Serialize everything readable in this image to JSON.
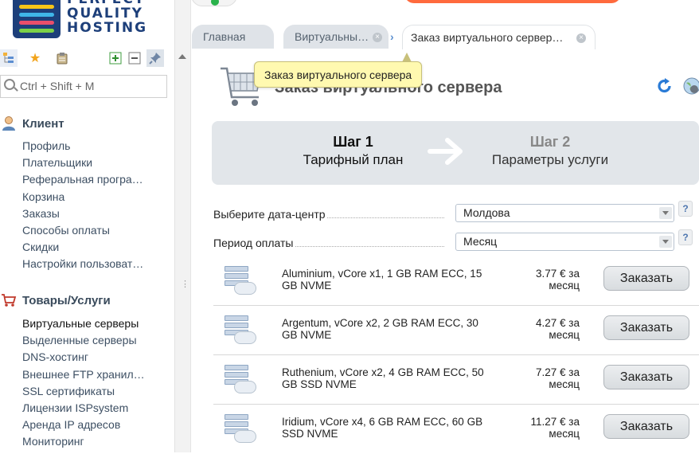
{
  "logo": {
    "line1": "PERFECT",
    "line2": "QUALITY",
    "line3": "HOSTING"
  },
  "search": {
    "placeholder": "Ctrl + Shift + M"
  },
  "sidebar": {
    "client_title": "Клиент",
    "client_items": [
      "Профиль",
      "Плательщики",
      "Реферальная програ…",
      "Корзина",
      "Заказы",
      "Способы оплаты",
      "Скидки",
      "Настройки пользоват…"
    ],
    "goods_title": "Товары/Услуги",
    "goods_items": [
      "Виртуальные серверы",
      "Выделенные серверы",
      "DNS-хостинг",
      "Внешнее FTP хранил…",
      "SSL сертификаты",
      "Лицензии ISPsystem",
      "Аренда IP адресов",
      "Мониторинг"
    ]
  },
  "tabs": [
    {
      "label": "Главная"
    },
    {
      "label": "Виртуальны…"
    },
    {
      "label": "Заказ виртуального сервер…"
    }
  ],
  "page": {
    "title": "Заказ виртуального сервера",
    "tooltip": "Заказ виртуального сервера"
  },
  "steps": [
    {
      "num": "Шаг 1",
      "label": "Тарифный план"
    },
    {
      "num": "Шаг 2",
      "label": "Параметры услуги"
    }
  ],
  "fields": {
    "datacenter_label": "Выберите дата-центр",
    "datacenter_value": "Молдова",
    "period_label": "Период оплаты",
    "period_value": "Месяц",
    "help": "?"
  },
  "plans": [
    {
      "name": "Aluminium, vCore x1, 1 GB RAM ECC, 15 GB NVME",
      "price": "3.77 € за месяц",
      "button": "Заказать"
    },
    {
      "name": "Argentum, vCore x2, 2 GB RAM ECC, 30 GB NVME",
      "price": "4.27 € за месяц",
      "button": "Заказать"
    },
    {
      "name": "Ruthenium, vCore x2, 4 GB RAM ECC, 50 GB SSD NVME",
      "price": "7.27 € за месяц",
      "button": "Заказать"
    },
    {
      "name": "Iridium, vCore x4, 6 GB RAM ECC, 60 GB SSD NVME",
      "price": "11.27 € за месяц",
      "button": "Заказать"
    }
  ],
  "colors": {
    "accent": "#2a7bd6",
    "brand": "#1d3f7a",
    "tooltip_bg": "#fff9b0"
  },
  "icons": [
    "tree-icon",
    "star-icon",
    "clipboard-icon",
    "plus-icon",
    "minus-icon",
    "pin-icon",
    "search-icon",
    "user-icon",
    "cart-icon",
    "refresh-icon",
    "globe-icon",
    "server-icon",
    "arrow-right-icon",
    "close-icon"
  ]
}
